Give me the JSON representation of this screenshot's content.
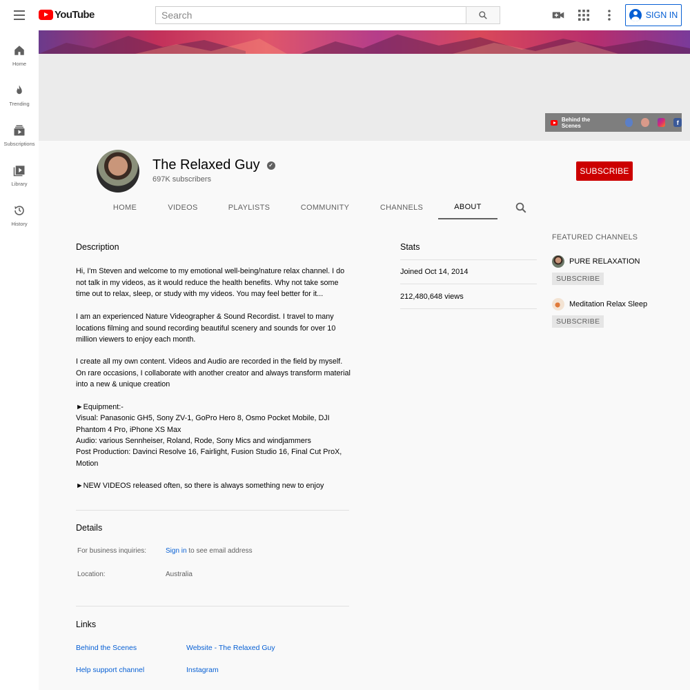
{
  "app": {
    "logo_text": "YouTube"
  },
  "search": {
    "placeholder": "Search"
  },
  "topbar": {
    "signin_label": "SIGN IN"
  },
  "leftnav": {
    "items": [
      {
        "label": "Home",
        "icon": "home-icon"
      },
      {
        "label": "Trending",
        "icon": "flame-icon"
      },
      {
        "label": "Subscriptions",
        "icon": "subscriptions-icon"
      },
      {
        "label": "Library",
        "icon": "library-icon"
      },
      {
        "label": "History",
        "icon": "history-icon"
      }
    ]
  },
  "banner": {
    "link_label": "Behind the Scenes",
    "icons": [
      "globe-icon",
      "shop-icon",
      "instagram-icon",
      "facebook-icon"
    ]
  },
  "channel": {
    "name": "The Relaxed Guy",
    "subscribers": "697K subscribers",
    "subscribe_label": "SUBSCRIBE"
  },
  "tabs": [
    {
      "label": "HOME"
    },
    {
      "label": "VIDEOS"
    },
    {
      "label": "PLAYLISTS"
    },
    {
      "label": "COMMUNITY"
    },
    {
      "label": "CHANNELS"
    },
    {
      "label": "ABOUT",
      "active": true
    }
  ],
  "about": {
    "description_title": "Description",
    "paragraphs": [
      "Hi, I'm Steven and welcome to my emotional well-being/nature relax channel. I do not talk in my videos, as it would reduce the health benefits. Why not take some time out to relax, sleep, or study with my videos. You may feel better for it...",
      "I am an experienced Nature Videographer & Sound Recordist. I travel to many locations filming and sound recording beautiful scenery and sounds for over 10 million viewers to enjoy each month.",
      "I create all my own content. Videos and Audio are recorded in the field by myself. On rare occasions, I collaborate with another creator and always transform material into a new & unique creation",
      "►Equipment:-",
      "Visual: Panasonic GH5, Sony ZV-1, GoPro Hero 8, Osmo Pocket Mobile, DJI Phantom 4 Pro, iPhone XS Max",
      "Audio: various Sennheiser, Roland, Rode, Sony Mics and windjammers",
      "Post Production: Davinci Resolve 16, Fairlight, Fusion Studio 16, Final Cut ProX, Motion",
      "►NEW VIDEOS released often, so there is always something new to enjoy"
    ],
    "details_title": "Details",
    "business_label": "For business inquiries:",
    "business_link": "Sign in",
    "business_rest": "to see email address",
    "location_label": "Location:",
    "location_value": "Australia",
    "links_title": "Links",
    "links": [
      "Behind the Scenes",
      "Website - The Relaxed Guy",
      "Help support channel",
      "Instagram"
    ]
  },
  "stats": {
    "title": "Stats",
    "joined": "Joined Oct 14, 2014",
    "views": "212,480,648 views"
  },
  "featured": {
    "title": "FEATURED CHANNELS",
    "channels": [
      {
        "name": "PURE RELAXATION",
        "subscribe_label": "SUBSCRIBE"
      },
      {
        "name": "Meditation Relax Sleep",
        "subscribe_label": "SUBSCRIBE"
      }
    ]
  },
  "colors": {
    "accent_blue": "#065fd4",
    "subscribe_red": "#cc0000",
    "brand_red": "#ff0000"
  }
}
